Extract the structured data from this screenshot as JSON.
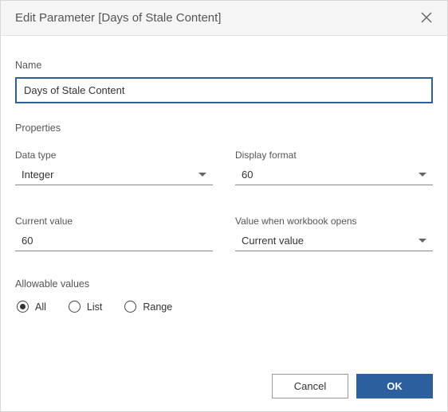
{
  "header": {
    "title": "Edit Parameter [Days of Stale Content]"
  },
  "name": {
    "label": "Name",
    "value": "Days of Stale Content"
  },
  "properties": {
    "heading": "Properties",
    "data_type": {
      "label": "Data type",
      "value": "Integer"
    },
    "display_format": {
      "label": "Display format",
      "value": "60"
    },
    "current_value": {
      "label": "Current value",
      "value": "60"
    },
    "value_on_open": {
      "label": "Value when workbook opens",
      "value": "Current value"
    }
  },
  "allowable": {
    "label": "Allowable values",
    "options": {
      "all": "All",
      "list": "List",
      "range": "Range"
    },
    "selected": "all"
  },
  "footer": {
    "cancel": "Cancel",
    "ok": "OK"
  }
}
